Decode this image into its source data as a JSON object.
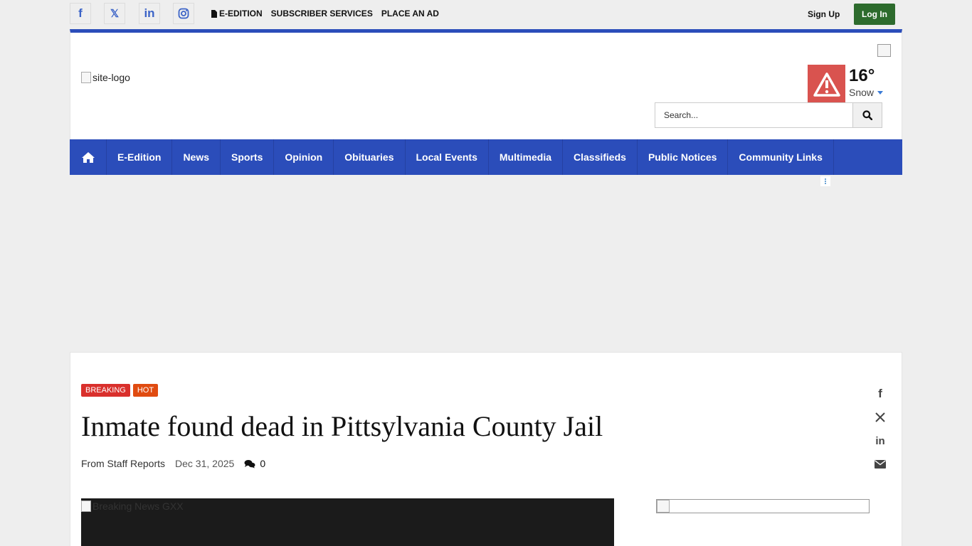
{
  "topbar": {
    "social": [
      {
        "name": "facebook",
        "glyph": "f"
      },
      {
        "name": "x",
        "glyph": "𝕏"
      },
      {
        "name": "linkedin",
        "glyph": "in"
      },
      {
        "name": "instagram",
        "glyph": "◎"
      }
    ],
    "links": [
      "E-EDITION",
      "SUBSCRIBER SERVICES",
      "PLACE AN AD"
    ],
    "signup_label": "Sign Up",
    "login_label": "Log In"
  },
  "header": {
    "logo_alt": "site-logo",
    "weather": {
      "temp": "16°",
      "condition": "Snow",
      "alert_color": "#d9534f"
    },
    "search": {
      "placeholder": "Search..."
    }
  },
  "nav": {
    "items": [
      "E-Edition",
      "News",
      "Sports",
      "Opinion",
      "Obituaries",
      "Local Events",
      "Multimedia",
      "Classifieds",
      "Public Notices",
      "Community Links"
    ]
  },
  "article": {
    "badges": [
      "BREAKING",
      "HOT"
    ],
    "headline": "Inmate found dead in Pittsylvania County Jail",
    "author": "From Staff Reports",
    "date": "Dec 31, 2025",
    "comment_count": "0",
    "hero_alt": "Breaking News GXX"
  },
  "colors": {
    "brand_blue": "#2b4dba",
    "login_green": "#2d6b2d",
    "badge_red": "#d9302c",
    "badge_orange": "#e04b10"
  }
}
